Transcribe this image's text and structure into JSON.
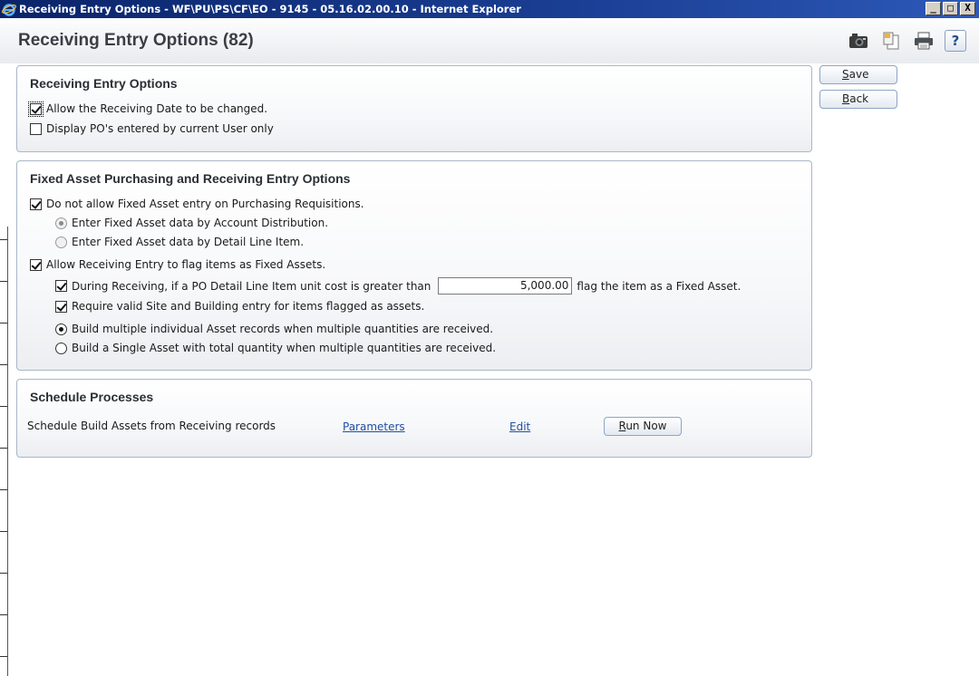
{
  "window": {
    "title": "Receiving Entry Options - WF\\PU\\PS\\CF\\EO - 9145 - 05.16.02.00.10 - Internet Explorer",
    "controls": [
      "_",
      "□",
      "X"
    ]
  },
  "header": {
    "title": "Receiving Entry Options (82)",
    "icons": [
      "camera-icon",
      "document-icon",
      "print-icon",
      "help-icon"
    ],
    "help_label": "?"
  },
  "side_buttons": {
    "save_accel": "S",
    "save_rest": "ave",
    "back_accel": "B",
    "back_rest": "ack"
  },
  "receiving_panel": {
    "title": "Receiving Entry Options",
    "allow_date_change": {
      "label": "Allow the Receiving Date to be changed.",
      "checked": true
    },
    "display_own_pos": {
      "label": "Display PO's entered by current User only",
      "checked": false
    }
  },
  "fixed_asset_panel": {
    "title": "Fixed Asset Purchasing and Receiving Entry Options",
    "no_fa_on_requisitions": {
      "label": "Do not allow Fixed Asset entry on Purchasing Requisitions.",
      "checked": true
    },
    "by_account_distribution": {
      "label": "Enter Fixed Asset data by Account Distribution.",
      "selected": true
    },
    "by_detail_line": {
      "label": "Enter Fixed Asset data by Detail Line Item.",
      "selected": false
    },
    "allow_flag": {
      "label": "Allow Receiving Entry to flag items as Fixed Assets.",
      "checked": true
    },
    "threshold_prefix": "During Receiving, if a PO Detail Line Item unit cost is greater than",
    "threshold_value": "5,000.00",
    "threshold_suffix": "flag the item as a Fixed Asset.",
    "require_site": {
      "label": "Require valid Site and Building entry for items flagged as assets.",
      "checked": true
    },
    "build_multiple": {
      "label": "Build multiple individual Asset records when multiple quantities are received.",
      "selected": true
    },
    "build_single": {
      "label": "Build a Single Asset with total quantity when multiple quantities are received.",
      "selected": false
    }
  },
  "schedule_panel": {
    "title": "Schedule Processes",
    "process_label": "Schedule Build Assets from Receiving records",
    "parameters_link": "Parameters",
    "edit_link": "Edit",
    "run_accel": "R",
    "run_rest": "un Now"
  }
}
